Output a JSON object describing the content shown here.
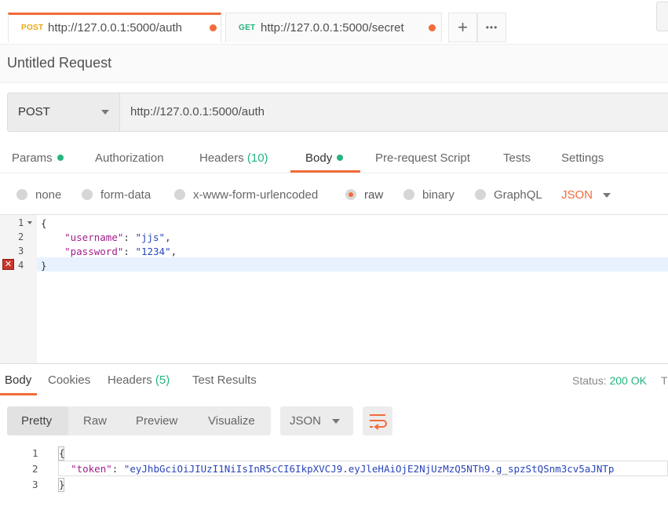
{
  "tabs": [
    {
      "method": "POST",
      "method_color": "#e5a818",
      "url": "http://127.0.0.1:5000/auth"
    },
    {
      "method": "GET",
      "method_color": "#26b47f",
      "url": "http://127.0.0.1:5000/secret"
    }
  ],
  "tab_actions": {
    "add": "+",
    "more": "•••"
  },
  "request": {
    "title": "Untitled Request",
    "method": "POST",
    "url": "http://127.0.0.1:5000/auth"
  },
  "request_tabs": {
    "params": "Params",
    "authorization": "Authorization",
    "headers": "Headers",
    "headers_count": "(10)",
    "body": "Body",
    "pre_request": "Pre-request Script",
    "tests": "Tests",
    "settings": "Settings"
  },
  "body_modes": {
    "none": "none",
    "form_data": "form-data",
    "urlencoded": "x-www-form-urlencoded",
    "raw": "raw",
    "binary": "binary",
    "graphql": "GraphQL",
    "format": "JSON"
  },
  "editor": {
    "line_numbers": [
      "1",
      "2",
      "3",
      "4"
    ],
    "line1": "{",
    "line2_key": "\"username\"",
    "line2_sep": ": ",
    "line2_val": "\"jjs\"",
    "line2_end": ",",
    "line3_key": "\"password\"",
    "line3_sep": ": ",
    "line3_val": "\"1234\"",
    "line3_end": ",",
    "line4": "}",
    "error_mark": "✕"
  },
  "response_tabs": {
    "body": "Body",
    "cookies": "Cookies",
    "headers": "Headers",
    "headers_count": "(5)",
    "test_results": "Test Results",
    "status_label": "Status:",
    "status_value": "200 OK",
    "truncated": "T"
  },
  "response_view": {
    "pretty": "Pretty",
    "raw": "Raw",
    "preview": "Preview",
    "visualize": "Visualize",
    "format": "JSON"
  },
  "response_body": {
    "line_numbers": [
      "1",
      "2",
      "3"
    ],
    "line1": "{",
    "line2_key": "\"token\"",
    "line2_sep": ": ",
    "line2_val": "\"eyJhbGciOiJIUzI1NiIsInR5cCI6IkpXVCJ9.eyJleHAiOjE2NjUzMzQ5NTh9.g_spzStQSnm3cv5aJNTp",
    "line3": "}"
  },
  "colors": {
    "accent": "#f26b3a",
    "success": "#26b47f"
  }
}
